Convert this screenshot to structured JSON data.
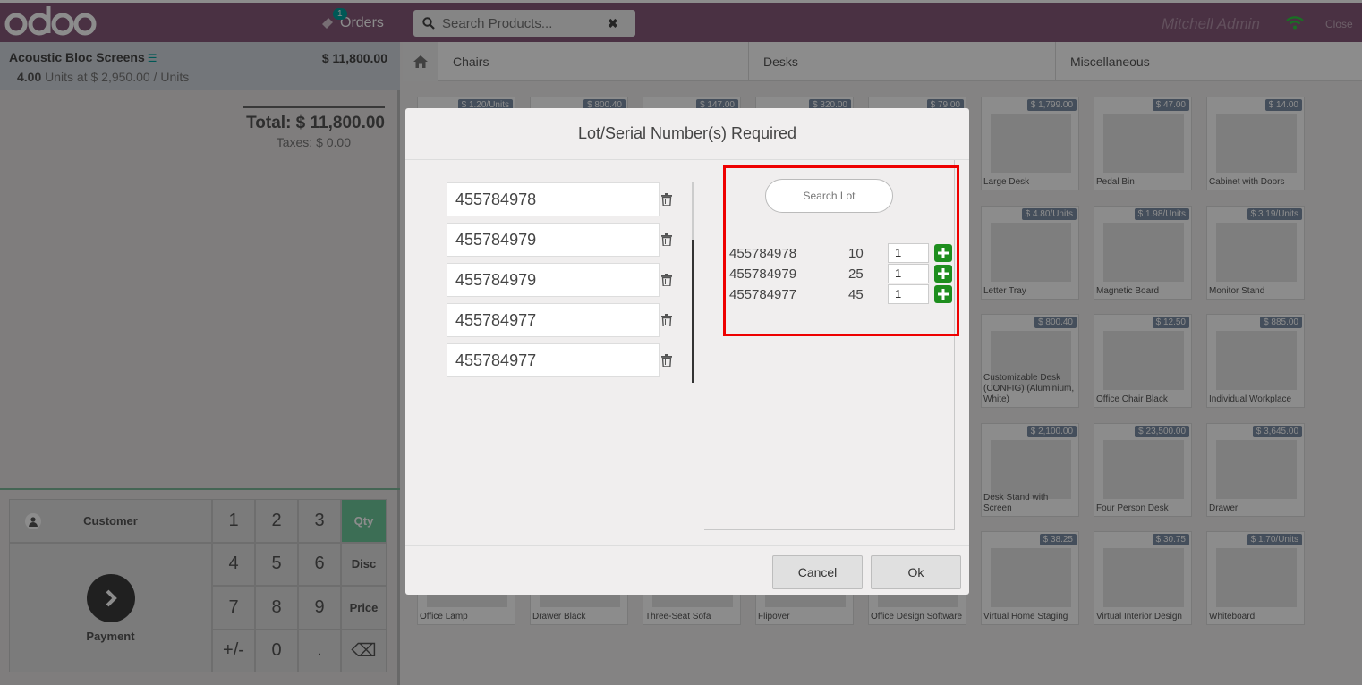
{
  "header": {
    "logo": "odoo",
    "orders_count": "1",
    "orders_label": "Orders",
    "search_placeholder": "Search Products...",
    "user": "Mitchell Admin",
    "close": "Close"
  },
  "order": {
    "line_name": "Acoustic Bloc Screens",
    "line_price": "$ 11,800.00",
    "line_qty": "4.00",
    "line_unit": "Units at $ 2,950.00 / Units",
    "total": "Total: $ 11,800.00",
    "taxes": "Taxes: $ 0.00"
  },
  "controls": {
    "customer": "Customer",
    "payment": "Payment",
    "keys": [
      "1",
      "2",
      "3",
      "Qty",
      "4",
      "5",
      "6",
      "Disc",
      "7",
      "8",
      "9",
      "Price",
      "+/-",
      "0",
      ".",
      "⌫"
    ]
  },
  "categories": [
    "Chairs",
    "Desks",
    "Miscellaneous"
  ],
  "products": [
    {
      "name": "",
      "price": "$ 1.20/Units"
    },
    {
      "name": "",
      "price": "$ 800.40"
    },
    {
      "name": "",
      "price": "$ 147.00"
    },
    {
      "name": "",
      "price": "$ 320.00"
    },
    {
      "name": "",
      "price": "$ 79.00"
    },
    {
      "name": "Large Desk",
      "price": "$ 1,799.00"
    },
    {
      "name": "Pedal Bin",
      "price": "$ 47.00"
    },
    {
      "name": "Cabinet with Doors",
      "price": "$ 14.00"
    },
    {
      "name": "Letter Tray",
      "price": "$ 4.80/Units"
    },
    {
      "name": "Magnetic Board",
      "price": "$ 1.98/Units"
    },
    {
      "name": "Monitor Stand",
      "price": "$ 3.19/Units"
    },
    {
      "name": "Customizable Desk (CONFIG) (Aluminium, White)",
      "price": "$ 800.40"
    },
    {
      "name": "Office Chair Black",
      "price": "$ 12.50"
    },
    {
      "name": "Individual Workplace",
      "price": "$ 885.00"
    },
    {
      "name": "Desk Stand with Screen",
      "price": "$ 2,100.00"
    },
    {
      "name": "Four Person Desk",
      "price": "$ 23,500.00"
    },
    {
      "name": "Drawer",
      "price": "$ 3,645.00"
    },
    {
      "name": "Office Lamp",
      "price": ""
    },
    {
      "name": "Drawer Black",
      "price": ""
    },
    {
      "name": "Three-Seat Sofa",
      "price": ""
    },
    {
      "name": "Flipover",
      "price": ""
    },
    {
      "name": "Office Design Software",
      "price": ""
    },
    {
      "name": "Virtual Home Staging",
      "price": "$ 38.25"
    },
    {
      "name": "Virtual Interior Design",
      "price": "$ 30.75"
    },
    {
      "name": "Whiteboard",
      "price": "$ 1.70/Units"
    }
  ],
  "modal": {
    "title": "Lot/Serial Number(s) Required",
    "entered_lots": [
      "455784978",
      "455784979",
      "455784979",
      "455784977",
      "455784977"
    ],
    "search_lot_placeholder": "Search Lot",
    "available_lots": [
      {
        "lot": "455784978",
        "qty": "10",
        "input": "1"
      },
      {
        "lot": "455784979",
        "qty": "25",
        "input": "1"
      },
      {
        "lot": "455784977",
        "qty": "45",
        "input": "1"
      }
    ],
    "cancel": "Cancel",
    "ok": "Ok"
  },
  "colors": {
    "header": "#875a7b",
    "highlight": "#e00000",
    "accent": "#00a09d",
    "qty_active": "#6ec89b"
  }
}
